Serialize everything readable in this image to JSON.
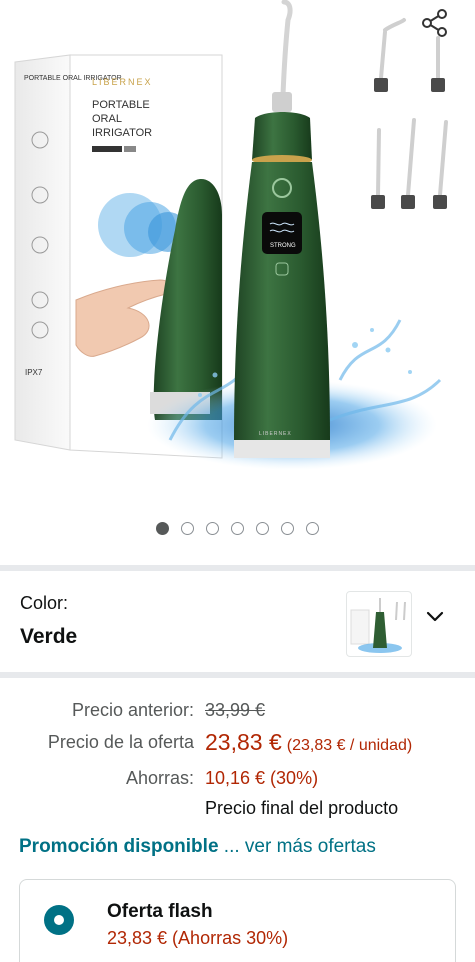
{
  "gallery": {
    "image_count": 7,
    "active_index": 0,
    "box_text": {
      "brand": "LIBERNEX",
      "title_lines": [
        "PORTABLE",
        "ORAL",
        "IRRIGATOR"
      ],
      "side_title": "PORTABLE ORAL IRRIGATOR",
      "side_marks": "IPX7"
    },
    "device_display": "STRONG"
  },
  "color_option": {
    "label": "Color:",
    "value": "Verde"
  },
  "pricing": {
    "previous_label": "Precio anterior:",
    "previous_value": "33,99 €",
    "offer_label": "Precio de la oferta",
    "offer_value": "23,83 €",
    "offer_unit": "(23,83 € / unidad)",
    "savings_label": "Ahorras:",
    "savings_value": "10,16 € (30%)",
    "final_note": "Precio final del producto"
  },
  "promotion": {
    "title": "Promoción disponible",
    "link": "... ver más ofertas"
  },
  "deal": {
    "title": "Oferta flash",
    "price": "23,83 € (Ahorras 30%)"
  },
  "colors": {
    "device_green": "#2f5e33",
    "price_red": "#b12704",
    "link_teal": "#007185"
  }
}
